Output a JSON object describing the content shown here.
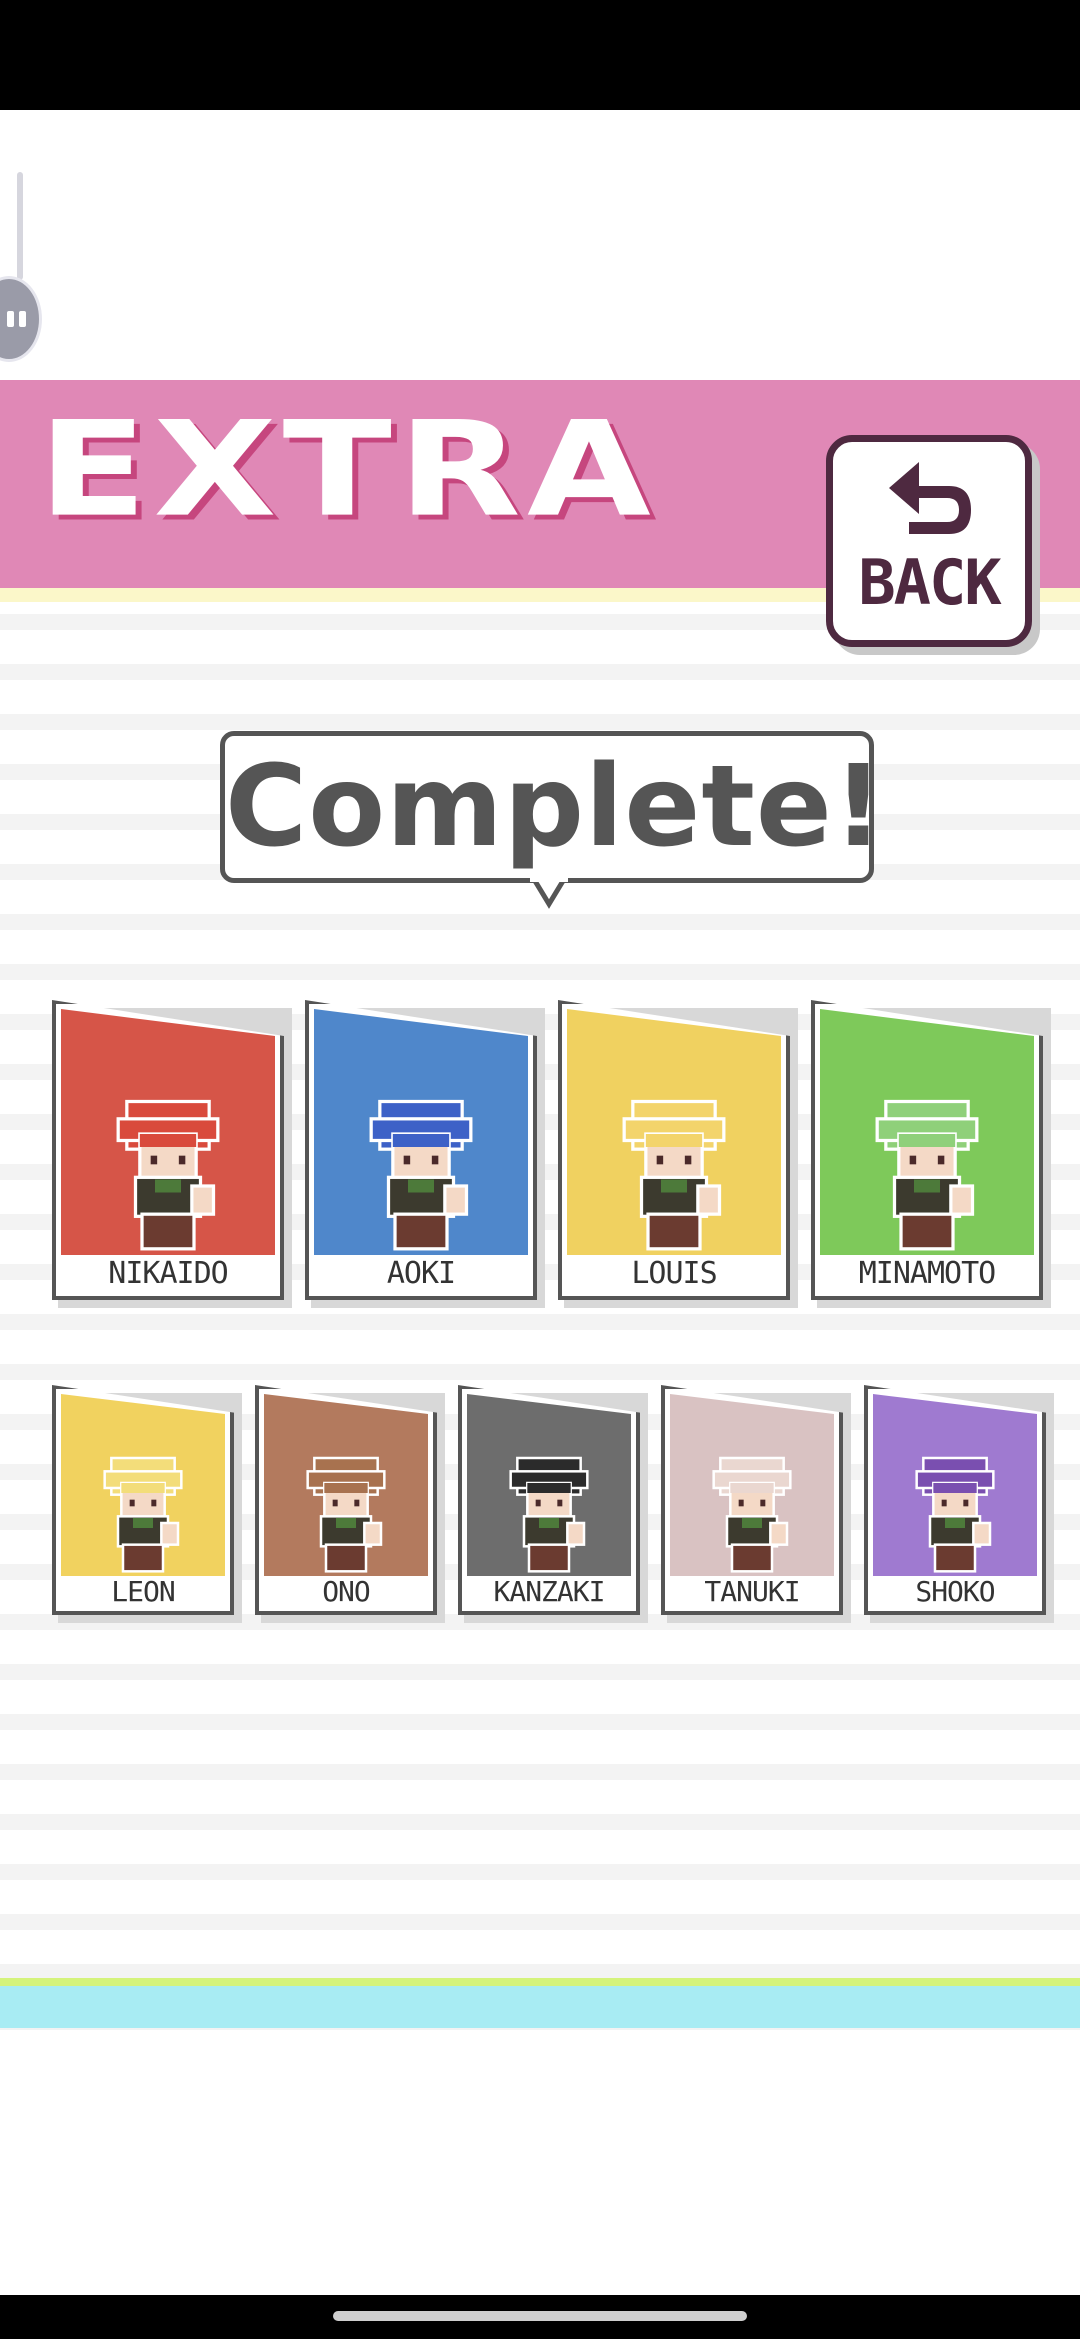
{
  "header": {
    "title": "EXTRA",
    "color": "#e088b6"
  },
  "back_button": {
    "label": "BACK"
  },
  "banner": {
    "text": "Complete!"
  },
  "colors": {
    "outline": "#4e2940",
    "bottom_green": "#d4f37a",
    "bottom_cyan": "#a8ecf3"
  },
  "characters": {
    "row1": [
      {
        "name": "NIKAIDO",
        "bg": "#d65548",
        "hair": "#d94a3c"
      },
      {
        "name": "AOKI",
        "bg": "#4f87cb",
        "hair": "#3d61c7"
      },
      {
        "name": "LOUIS",
        "bg": "#f0d160",
        "hair": "#f3d46b"
      },
      {
        "name": "MINAMOTO",
        "bg": "#7ec95a",
        "hair": "#8fd07a"
      }
    ],
    "row2": [
      {
        "name": "LEON",
        "bg": "#f1d25f",
        "hair": "#f3dd7a"
      },
      {
        "name": "ONO",
        "bg": "#b37a5e",
        "hair": "#a8724f"
      },
      {
        "name": "KANZAKI",
        "bg": "#6d6d6d",
        "hair": "#2b2b2b"
      },
      {
        "name": "TANUKI",
        "bg": "#d9c2c2",
        "hair": "#ead7d0"
      },
      {
        "name": "SHOKO",
        "bg": "#9f7ad0",
        "hair": "#7a4fb0"
      }
    ]
  }
}
